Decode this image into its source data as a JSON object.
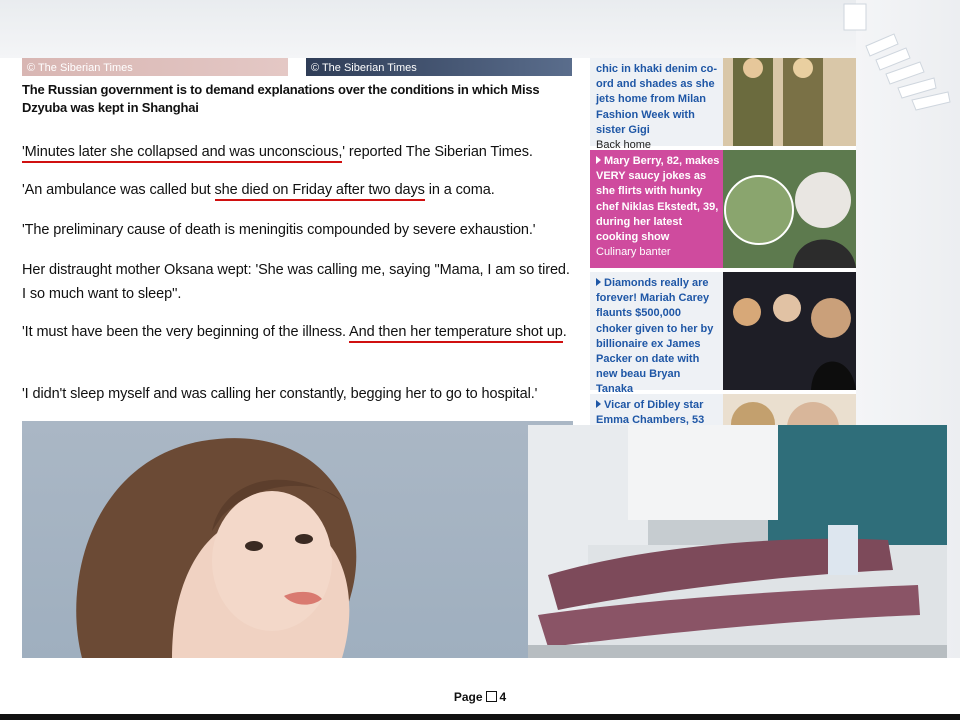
{
  "article": {
    "photo_credit_left": "© The Siberian Times",
    "photo_credit_right": "© The Siberian Times",
    "caption": "The Russian government is to demand explanations over the conditions in which Miss Dzyuba was kept in Shanghai",
    "p1": {
      "a": "'Minutes later she collapsed and was unconscious,",
      "b": "' reported The Siberian Times."
    },
    "p2": {
      "a": "'An ambulance was called but ",
      "b": "she died on Friday after two days",
      "c": " in a coma."
    },
    "p3": "'The preliminary cause of death is meningitis compounded by severe exhaustion.'",
    "p4": "Her distraught mother Oksana wept: 'She was calling me, saying ''Mama, I am so tired. I so much want to sleep''.",
    "p5": {
      "a": "'It must have been the very beginning of the illness. ",
      "b": "And then her temperature shot up",
      "c": "."
    },
    "p6": "'I didn't sleep myself and was calling her constantly, begging her to go to hospital.'"
  },
  "sidebar": {
    "item1": {
      "text": "chic in khaki denim co-ord and shades as she jets home from Milan Fashion Week with sister Gigi",
      "category": "Back home"
    },
    "item2": {
      "text": "Mary Berry, 82, makes VERY saucy jokes as she flirts with hunky chef Niklas Ekstedt, 39, during her latest cooking show",
      "category": "Culinary banter"
    },
    "item3": {
      "text": "Diamonds really are forever! Mariah Carey flaunts $500,000 choker given to her by billionaire ex James Packer on date with new beau Bryan Tanaka"
    },
    "item4": {
      "text": "Vicar of Dibley star Emma Chambers, 53"
    }
  },
  "footer": {
    "page_label": "Page",
    "page_number": "4"
  },
  "colors": {
    "underline": "#d01010",
    "sidebar_link": "#1f57a6",
    "sidebar_highlight": "#cf4b9e"
  },
  "icons": {
    "bullet": "triangle-bullet-icon",
    "footer_box": "square-box-icon"
  }
}
